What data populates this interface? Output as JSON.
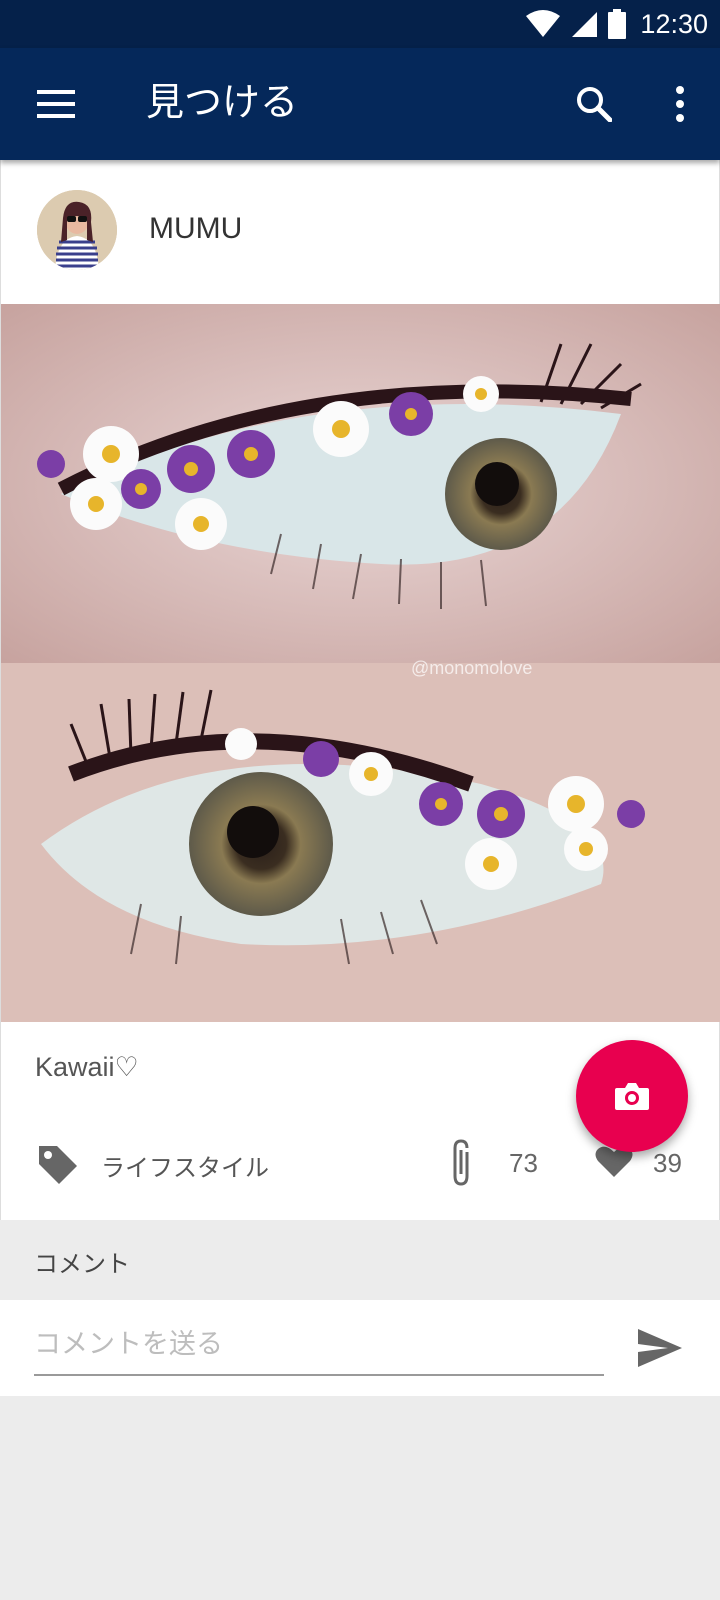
{
  "status_bar": {
    "time": "12:30",
    "icons": [
      "wifi-icon",
      "signal-icon",
      "battery-icon"
    ]
  },
  "app_bar": {
    "title": "見つける",
    "menu_icon": "menu-icon",
    "search_icon": "search-icon",
    "more_icon": "more-vert-icon"
  },
  "post": {
    "author": "MUMU",
    "image_watermark": "@monomolove",
    "caption": "Kawaii♡",
    "category": "ライフスタイル",
    "clip_count": "73",
    "like_count": "39"
  },
  "fab": {
    "icon": "camera-icon"
  },
  "comments": {
    "header": "コメント",
    "input_placeholder": "コメントを送る",
    "send_icon": "send-icon"
  },
  "colors": {
    "status_bar": "#05214a",
    "app_bar": "#05285a",
    "fab": "#e8004f",
    "background": "#ececec"
  }
}
